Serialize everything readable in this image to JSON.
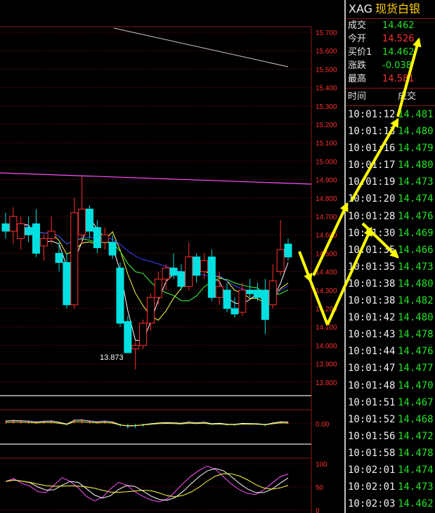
{
  "quote": {
    "code": "XAG",
    "name": "现货白银",
    "rows": [
      {
        "label": "成交",
        "value": "14.462",
        "color": "green"
      },
      {
        "label": "今开",
        "value": "14.526",
        "color": "red"
      },
      {
        "label": "买价1",
        "value": "14.462",
        "color": "green"
      },
      {
        "label": "涨跌",
        "value": "-0.038",
        "color": "green"
      },
      {
        "label": "最高",
        "value": "14.581",
        "color": "red"
      }
    ]
  },
  "ticks": {
    "col_time": "时间",
    "col_price": "成交",
    "rows": [
      {
        "time": "10:01:12",
        "price": "14.481"
      },
      {
        "time": "10:01:13",
        "price": "14.480"
      },
      {
        "time": "10:01:16",
        "price": "14.479"
      },
      {
        "time": "10:01:17",
        "price": "14.480"
      },
      {
        "time": "10:01:19",
        "price": "14.473"
      },
      {
        "time": "10:01:20",
        "price": "14.474"
      },
      {
        "time": "10:01:28",
        "price": "14.476"
      },
      {
        "time": "10:01:30",
        "price": "14.469"
      },
      {
        "time": "10:01:35",
        "price": "14.466"
      },
      {
        "time": "10:01:35",
        "price": "14.473"
      },
      {
        "time": "10:01:38",
        "price": "14.480"
      },
      {
        "time": "10:01:38",
        "price": "14.482"
      },
      {
        "time": "10:01:42",
        "price": "14.480"
      },
      {
        "time": "10:01:43",
        "price": "14.478"
      },
      {
        "time": "10:01:44",
        "price": "14.476"
      },
      {
        "time": "10:01:47",
        "price": "14.477"
      },
      {
        "time": "10:01:48",
        "price": "14.470"
      },
      {
        "time": "10:01:51",
        "price": "14.467"
      },
      {
        "time": "10:01:52",
        "price": "14.468"
      },
      {
        "time": "10:01:56",
        "price": "14.472"
      },
      {
        "time": "10:01:58",
        "price": "14.478"
      },
      {
        "time": "10:02:01",
        "price": "14.474"
      },
      {
        "time": "10:02:01",
        "price": "14.473"
      },
      {
        "time": "10:02:03",
        "price": "14.462"
      }
    ]
  },
  "chart_data": {
    "type": "candlestick",
    "price_axis": {
      "ticks": [
        "15.700",
        "15.600",
        "15.500",
        "15.400",
        "15.300",
        "15.200",
        "15.100",
        "15.000",
        "14.900",
        "14.800",
        "14.700",
        "14.600",
        "14.500",
        "14.400",
        "14.300",
        "14.200",
        "14.100",
        "14.000",
        "13.900",
        "13.800"
      ],
      "range": [
        13.75,
        15.75
      ]
    },
    "low_marker": {
      "label": "13.873",
      "value": 13.873
    },
    "macd_axis": {
      "ticks": [
        "0.00"
      ]
    },
    "osc_axis": {
      "ticks": [
        "100",
        "50",
        "0"
      ],
      "range": [
        0,
        100
      ]
    },
    "candles": [
      {
        "o": 14.66,
        "h": 14.72,
        "l": 14.58,
        "c": 14.62
      },
      {
        "o": 14.62,
        "h": 14.75,
        "l": 14.55,
        "c": 14.7
      },
      {
        "o": 14.58,
        "h": 14.7,
        "l": 14.52,
        "c": 14.66
      },
      {
        "o": 14.64,
        "h": 14.7,
        "l": 14.56,
        "c": 14.6
      },
      {
        "o": 14.66,
        "h": 14.74,
        "l": 14.48,
        "c": 14.5
      },
      {
        "o": 14.54,
        "h": 14.6,
        "l": 14.46,
        "c": 14.58
      },
      {
        "o": 14.58,
        "h": 14.7,
        "l": 14.55,
        "c": 14.62
      },
      {
        "o": 14.5,
        "h": 14.56,
        "l": 14.4,
        "c": 14.45
      },
      {
        "o": 14.45,
        "h": 14.5,
        "l": 14.2,
        "c": 14.22
      },
      {
        "o": 14.22,
        "h": 14.8,
        "l": 14.2,
        "c": 14.72
      },
      {
        "o": 14.6,
        "h": 14.92,
        "l": 14.55,
        "c": 14.74
      },
      {
        "o": 14.74,
        "h": 14.76,
        "l": 14.58,
        "c": 14.62
      },
      {
        "o": 14.64,
        "h": 14.68,
        "l": 14.5,
        "c": 14.53
      },
      {
        "o": 14.56,
        "h": 14.64,
        "l": 14.52,
        "c": 14.6
      },
      {
        "o": 14.56,
        "h": 14.6,
        "l": 14.47,
        "c": 14.49
      },
      {
        "o": 14.42,
        "h": 14.45,
        "l": 14.1,
        "c": 14.12
      },
      {
        "o": 14.13,
        "h": 14.16,
        "l": 13.96,
        "c": 13.96
      },
      {
        "o": 13.98,
        "h": 14.02,
        "l": 13.87,
        "c": 14.0
      },
      {
        "o": 14.0,
        "h": 14.14,
        "l": 13.98,
        "c": 14.12
      },
      {
        "o": 14.12,
        "h": 14.28,
        "l": 14.08,
        "c": 14.26
      },
      {
        "o": 14.26,
        "h": 14.4,
        "l": 14.22,
        "c": 14.36
      },
      {
        "o": 14.36,
        "h": 14.44,
        "l": 14.3,
        "c": 14.42
      },
      {
        "o": 14.42,
        "h": 14.5,
        "l": 14.36,
        "c": 14.38
      },
      {
        "o": 14.4,
        "h": 14.44,
        "l": 14.3,
        "c": 14.32
      },
      {
        "o": 14.32,
        "h": 14.56,
        "l": 14.3,
        "c": 14.48
      },
      {
        "o": 14.48,
        "h": 14.5,
        "l": 14.34,
        "c": 14.38
      },
      {
        "o": 14.4,
        "h": 14.5,
        "l": 14.36,
        "c": 14.46
      },
      {
        "o": 14.48,
        "h": 14.52,
        "l": 14.24,
        "c": 14.26
      },
      {
        "o": 14.26,
        "h": 14.4,
        "l": 14.22,
        "c": 14.32
      },
      {
        "o": 14.3,
        "h": 14.34,
        "l": 14.18,
        "c": 14.2
      },
      {
        "o": 14.2,
        "h": 14.26,
        "l": 14.15,
        "c": 14.17
      },
      {
        "o": 14.18,
        "h": 14.34,
        "l": 14.16,
        "c": 14.3
      },
      {
        "o": 14.3,
        "h": 14.36,
        "l": 14.26,
        "c": 14.28
      },
      {
        "o": 14.3,
        "h": 14.34,
        "l": 14.24,
        "c": 14.26
      },
      {
        "o": 14.3,
        "h": 14.36,
        "l": 14.06,
        "c": 14.14
      },
      {
        "o": 14.22,
        "h": 14.44,
        "l": 14.2,
        "c": 14.35
      },
      {
        "o": 14.4,
        "h": 14.68,
        "l": 14.38,
        "c": 14.52
      },
      {
        "o": 14.55,
        "h": 14.58,
        "l": 14.46,
        "c": 14.48
      }
    ],
    "colors": {
      "up": "#ff3030",
      "down": "#00e0e0",
      "ma_white": "#ffffff",
      "ma_yellow": "#ffff40",
      "ma_green": "#40ff40",
      "ma_blue": "#4040ff",
      "ma_magenta": "#ff50ff",
      "grid": "#8a1a1a",
      "axis_text": "#ff3030",
      "annotation": "#ffff00"
    }
  }
}
